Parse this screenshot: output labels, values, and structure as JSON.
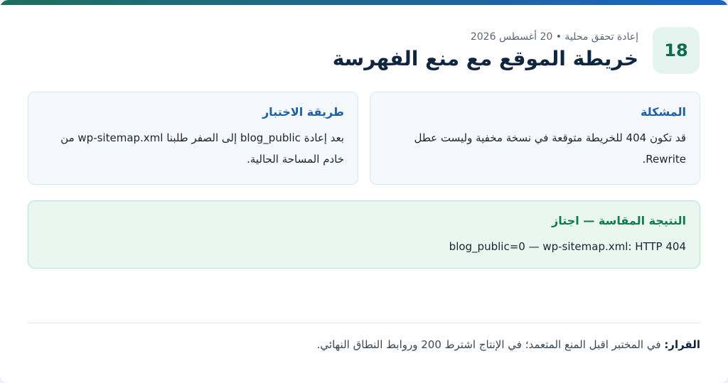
{
  "header": {
    "number": "18",
    "meta": "إعادة تحقق محلية • 20 أغسطس 2026",
    "title": "خريطة الموقع مع منع الفهرسة"
  },
  "problem": {
    "heading": "المشكلة",
    "body": "قد تكون 404 للخريطة متوقعة في نسخة مخفية وليست عطل Rewrite."
  },
  "method": {
    "heading": "طريقة الاختبار",
    "body": "بعد إعادة blog_public إلى الصفر طلبنا wp-sitemap.xml من خادم المساحة الحالية."
  },
  "result": {
    "heading": "النتيجة المقاسة — اجتاز",
    "body": "blog_public=0 — wp-sitemap.xml: HTTP 404"
  },
  "decision": {
    "label": "القرار:",
    "text": "في المختبر اقبل المنع المتعمد؛ في الإنتاج اشترط 200 وروابط النطاق النهائي."
  },
  "colors": {
    "accent_green": "#0f7b55",
    "accent_blue": "#1d5fa6",
    "title": "#0f2540"
  }
}
